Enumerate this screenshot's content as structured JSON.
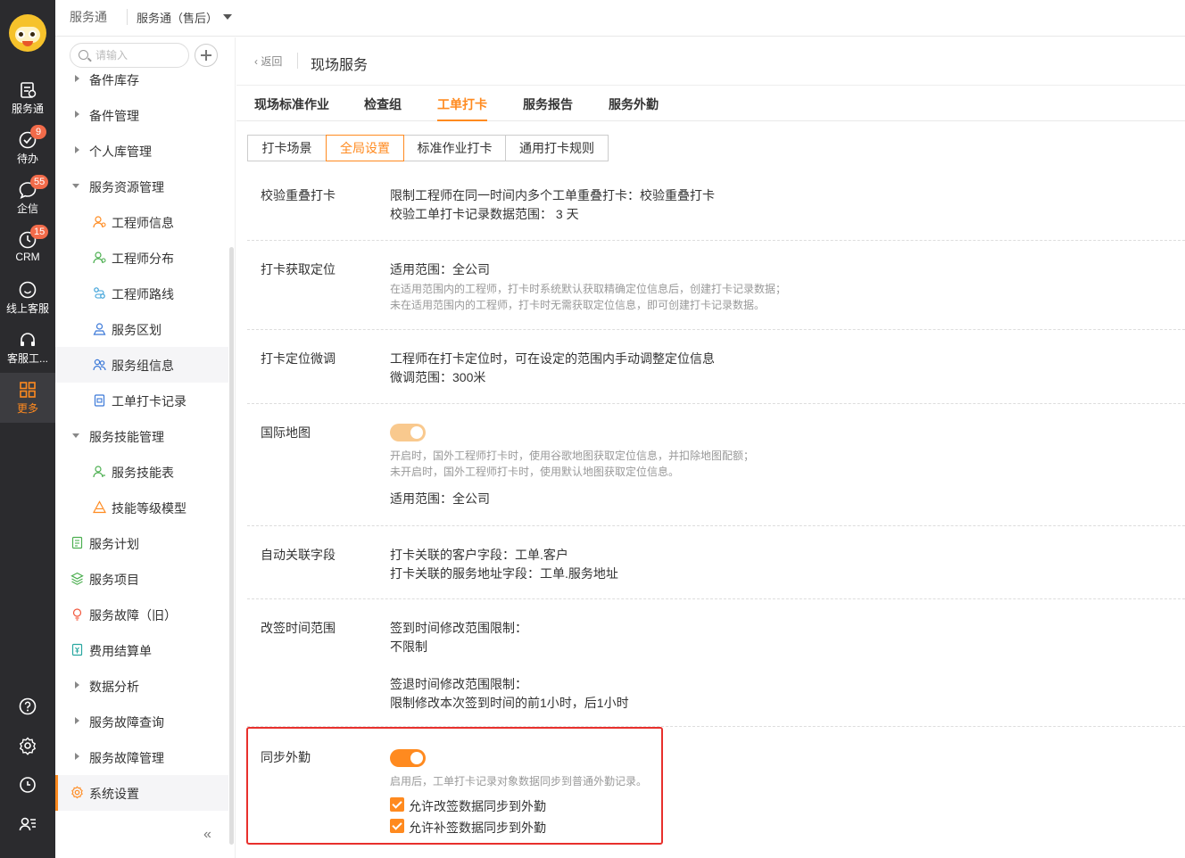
{
  "rail": {
    "items": [
      {
        "label": "服务通",
        "icon": "clipboard-icon",
        "badge": ""
      },
      {
        "label": "待办",
        "icon": "check-circle-icon",
        "badge": "9"
      },
      {
        "label": "企信",
        "icon": "chat-icon",
        "badge": "55"
      },
      {
        "label": "CRM",
        "icon": "clock-icon",
        "badge": "15"
      },
      {
        "label": "线上客服",
        "icon": "smile-chat-icon",
        "badge": ""
      },
      {
        "label": "客服工...",
        "icon": "headset-icon",
        "badge": ""
      },
      {
        "label": "更多",
        "icon": "grid-icon",
        "badge": ""
      }
    ],
    "bottom_icons": [
      "help-icon",
      "settings-icon",
      "history-icon",
      "user-list-icon"
    ],
    "active_color": "#ff8a1f"
  },
  "topbar": {
    "app_name": "服务通",
    "app_selector": "服务通（售后）"
  },
  "sidebar": {
    "search_placeholder": "请输入",
    "items": [
      {
        "label": "备件库存",
        "type": "group-collapsed"
      },
      {
        "label": "备件管理",
        "type": "group-collapsed"
      },
      {
        "label": "个人库管理",
        "type": "group-collapsed"
      },
      {
        "label": "服务资源管理",
        "type": "group-expanded"
      },
      {
        "label": "工程师信息",
        "type": "child",
        "icon": "engineer-icon"
      },
      {
        "label": "工程师分布",
        "type": "child",
        "icon": "map-pin-user-icon"
      },
      {
        "label": "工程师路线",
        "type": "child",
        "icon": "route-icon"
      },
      {
        "label": "服务区划",
        "type": "child",
        "icon": "region-icon"
      },
      {
        "label": "服务组信息",
        "type": "child",
        "icon": "team-icon"
      },
      {
        "label": "工单打卡记录",
        "type": "child",
        "icon": "checkin-record-icon"
      },
      {
        "label": "服务技能管理",
        "type": "group-expanded"
      },
      {
        "label": "服务技能表",
        "type": "child",
        "icon": "skill-icon"
      },
      {
        "label": "技能等级模型",
        "type": "child",
        "icon": "triangle-icon"
      },
      {
        "label": "服务计划",
        "type": "leaf",
        "icon": "plan-icon"
      },
      {
        "label": "服务项目",
        "type": "leaf",
        "icon": "layers-icon"
      },
      {
        "label": "服务故障（旧）",
        "type": "leaf",
        "icon": "bulb-icon"
      },
      {
        "label": "费用结算单",
        "type": "leaf",
        "icon": "invoice-icon"
      },
      {
        "label": "数据分析",
        "type": "group-collapsed"
      },
      {
        "label": "服务故障查询",
        "type": "group-collapsed"
      },
      {
        "label": "服务故障管理",
        "type": "group-collapsed"
      },
      {
        "label": "系统设置",
        "type": "leaf-active",
        "icon": "gear-icon"
      }
    ],
    "collapse_glyph": "«"
  },
  "page": {
    "back_label": "返回",
    "title": "现场服务",
    "tabs": [
      "现场标准作业",
      "检查组",
      "工单打卡",
      "服务报告",
      "服务外勤"
    ],
    "active_tab": "工单打卡",
    "subtabs": [
      "打卡场景",
      "全局设置",
      "标准作业打卡",
      "通用打卡规则"
    ],
    "active_subtab": "全局设置"
  },
  "settings": {
    "overlap": {
      "label": "校验重叠打卡",
      "line1": "限制工程师在同一时间内多个工单重叠打卡：校验重叠打卡",
      "line2": "校验工单打卡记录数据范围： 3 天"
    },
    "location": {
      "label": "打卡获取定位",
      "scope": "适用范围：全公司",
      "hint1": "在适用范围内的工程师，打卡时系统默认获取精确定位信息后，创建打卡记录数据；",
      "hint2": "未在适用范围内的工程师，打卡时无需获取定位信息，即可创建打卡记录数据。"
    },
    "adjust": {
      "label": "打卡定位微调",
      "line1": "工程师在打卡定位时，可在设定的范围内手动调整定位信息",
      "line2": "微调范围：300米"
    },
    "intl_map": {
      "label": "国际地图",
      "enabled": true,
      "hint1": "开启时，国外工程师打卡时，使用谷歌地图获取定位信息，并扣除地图配额；",
      "hint2": "未开启时，国外工程师打卡时，使用默认地图获取定位信息。",
      "scope": "适用范围：全公司"
    },
    "auto_link": {
      "label": "自动关联字段",
      "line1": "打卡关联的客户字段：工单.客户",
      "line2": "打卡关联的服务地址字段：工单.服务地址"
    },
    "resign": {
      "label": "改签时间范围",
      "in_title": "签到时间修改范围限制：",
      "in_value": "不限制",
      "out_title": "签退时间修改范围限制：",
      "out_value": "限制修改本次签到时间的前1小时，后1小时"
    },
    "sync": {
      "label": "同步外勤",
      "enabled": true,
      "hint": "启用后，工单打卡记录对象数据同步到普通外勤记录。",
      "check1": "允许改签数据同步到外勤",
      "check1_checked": true,
      "check2": "允许补签数据同步到外勤",
      "check2_checked": true
    }
  },
  "colors": {
    "accent": "#ff8a1f",
    "rail_bg": "#2b2b2e",
    "highlight_box": "#e8302c",
    "badge": "#f26b4a"
  }
}
